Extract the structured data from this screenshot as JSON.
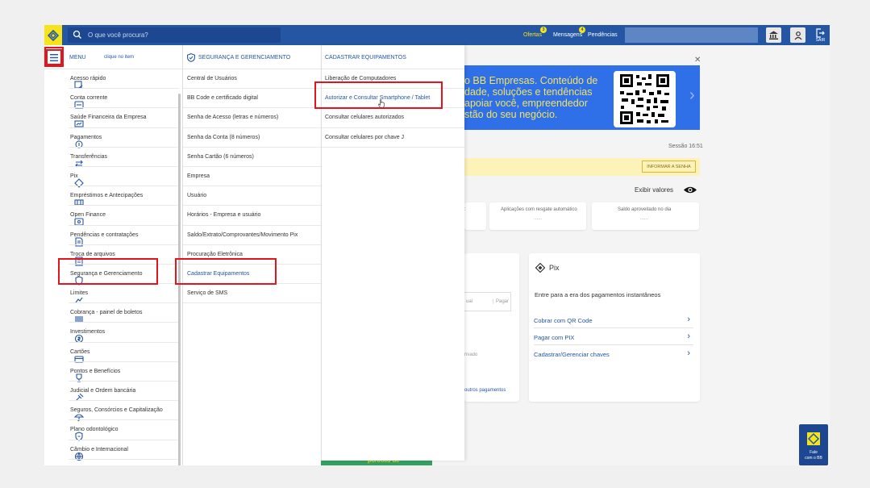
{
  "search": {
    "placeholder": "O que você procura?"
  },
  "topbar": {
    "offers_label": "Ofertas",
    "offers_badge": "3",
    "messages_label": "Mensagens",
    "messages_badge": "4",
    "pending_label": "Pendências",
    "exit_label": "SAIR"
  },
  "menu": {
    "title": "MENU",
    "hint": "clique no item",
    "items": [
      "Acesso rápido",
      "Conta corrente",
      "Saúde Financeira da Empresa",
      "Pagamentos",
      "Transferências",
      "Pix",
      "Empréstimos e Antecipações",
      "Open Finance",
      "Pendências e contratações",
      "Troca de arquivos",
      "Segurança e Gerenciamento",
      "Limites",
      "Cobrança - painel de boletos",
      "Investimentos",
      "Cartões",
      "Pontos e Benefícios",
      "Judicial e Ordem bancária",
      "Seguros, Consórcios e Capitalização",
      "Plano odontológico",
      "Câmbio e Internacional"
    ]
  },
  "submenu": {
    "title": "SEGURANÇA E GERENCIAMENTO",
    "items": [
      "Central de Usuários",
      "BB Code e certificado digital",
      "Senha de Acesso (letras e números)",
      "Senha da Conta (8 números)",
      "Senha Cartão (6 números)",
      "Empresa",
      "Usuário",
      "Horários - Empresa e usuário",
      "Saldo/Extrato/Comprovantes/Movimento Pix",
      "Procuração Eletrônica",
      "Cadastrar Equipamentos",
      "Serviço de SMS"
    ]
  },
  "submenu2": {
    "title": "CADASTRAR EQUIPAMENTOS",
    "items": [
      "Liberação de Computadores",
      "Autorizar e Consultar Smartphone / Tablet",
      "Consultar celulares autorizados",
      "Consultar celulares por chave J"
    ]
  },
  "banner": {
    "line1": "o BB Empresas. Conteúdo de",
    "line2": "dade, soluções e tendências",
    "line3": "apoiar você, empreendedor",
    "line4": "stão do seu negócio."
  },
  "session": "Sessão 16:51",
  "inform_button": "INFORMAR A SENHA",
  "show_values": "Exibir valores",
  "cards": {
    "c1_label": "Aplicações com resgate automático",
    "c1_value": "......",
    "c2_label": "Saldo aproveitado no dia",
    "c2_value": "......",
    "colon": ":",
    "partial1": "ual",
    "partial2": "Pagar",
    "partial3": "nvado",
    "partial4": "outros pagamentos"
  },
  "pix": {
    "title": "Pix",
    "desc": "Entre para a era dos pagamentos instantâneos",
    "link1": "Cobrar com QR Code",
    "link2": "Pagar com PIX",
    "link3": "Cadastrar/Gerenciar chaves"
  },
  "promo_text": "portfólio de",
  "fale": {
    "line1": "Fale",
    "line2": "com o BB"
  },
  "colors": {
    "brand_blue": "#2456a4",
    "brand_yellow": "#f7e31a",
    "highlight_red": "#e3141c",
    "banner_blue": "#2f6fe8"
  }
}
